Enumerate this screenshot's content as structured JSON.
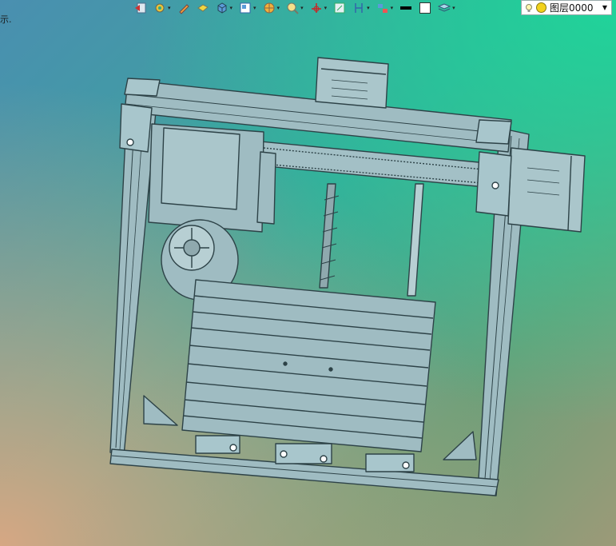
{
  "status_fragment": "示.",
  "toolbar": {
    "buttons": [
      {
        "icon": "ucs-back-icon",
        "dropdown": false
      },
      {
        "icon": "snap-settings-icon",
        "dropdown": true
      },
      {
        "icon": "sketch-pencil-icon",
        "dropdown": false
      },
      {
        "icon": "surface-block-icon",
        "dropdown": false
      },
      {
        "icon": "solid-cube-icon",
        "dropdown": true
      },
      {
        "icon": "view-orientation-icon",
        "dropdown": true
      },
      {
        "icon": "render-sphere-icon",
        "dropdown": true
      },
      {
        "icon": "zoom-lens-icon",
        "dropdown": true
      },
      {
        "icon": "axis-move-icon",
        "dropdown": true
      },
      {
        "icon": "frame-select-icon",
        "dropdown": false
      },
      {
        "icon": "dimension-icon",
        "dropdown": true
      },
      {
        "icon": "align-icon",
        "dropdown": true
      },
      {
        "icon": "line-weight-icon",
        "dropdown": false
      },
      {
        "icon": "color-swatch-icon",
        "dropdown": false
      },
      {
        "icon": "layers-stack-icon",
        "dropdown": true
      }
    ],
    "layer_selector": {
      "value": "图层0000",
      "icon": "lightbulb-icon"
    }
  },
  "colors": {
    "part_fill": "#9fbcc2",
    "part_stroke": "#2d4247",
    "motor_fill": "#aac6cb"
  }
}
